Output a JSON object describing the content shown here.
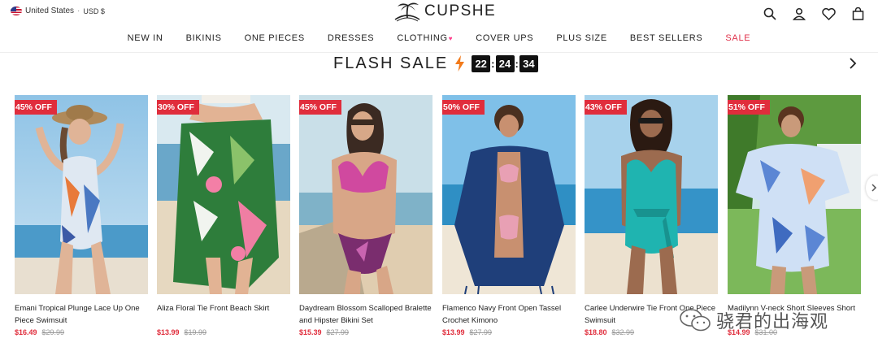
{
  "header": {
    "locale": "United States",
    "separator": "·",
    "currency": "USD $",
    "brand": "CUPSHE",
    "icons": [
      "search-icon",
      "account-icon",
      "wishlist-icon",
      "bag-icon"
    ]
  },
  "nav": {
    "items": [
      {
        "label": "NEW IN"
      },
      {
        "label": "BIKINIS"
      },
      {
        "label": "ONE PIECES"
      },
      {
        "label": "DRESSES"
      },
      {
        "label": "CLOTHING",
        "heart": "♥"
      },
      {
        "label": "COVER UPS"
      },
      {
        "label": "PLUS SIZE"
      },
      {
        "label": "BEST SELLERS"
      },
      {
        "label": "SALE"
      }
    ],
    "sale_color": "#e0334c"
  },
  "flash_sale": {
    "title": "FLASH SALE",
    "timer": {
      "hours": "22",
      "minutes": "24",
      "seconds": "34"
    }
  },
  "products": [
    {
      "badge": "45% OFF",
      "name": "Emani Tropical Plunge Lace Up One Piece Swimsuit",
      "price": "$16.49",
      "original": "$29.99"
    },
    {
      "badge": "30% OFF",
      "name": "Aliza Floral Tie Front Beach Skirt",
      "price": "$13.99",
      "original": "$19.99"
    },
    {
      "badge": "45% OFF",
      "name": "Daydream Blossom Scalloped Bralette and Hipster Bikini Set",
      "price": "$15.39",
      "original": "$27.99"
    },
    {
      "badge": "50% OFF",
      "name": "Flamenco Navy Front Open Tassel Crochet Kimono",
      "price": "$13.99",
      "original": "$27.99"
    },
    {
      "badge": "43% OFF",
      "name": "Carlee Underwire Tie Front One Piece Swimsuit",
      "price": "$18.80",
      "original": "$32.99"
    },
    {
      "badge": "51% OFF",
      "name": "Madilynn V-neck Short Sleeves Short",
      "price": "$14.99",
      "original": "$31.00"
    }
  ],
  "watermark": {
    "text": "骁君的出海观"
  },
  "colors": {
    "badge": "#e02d3c",
    "accent_price": "#e02d3c"
  }
}
